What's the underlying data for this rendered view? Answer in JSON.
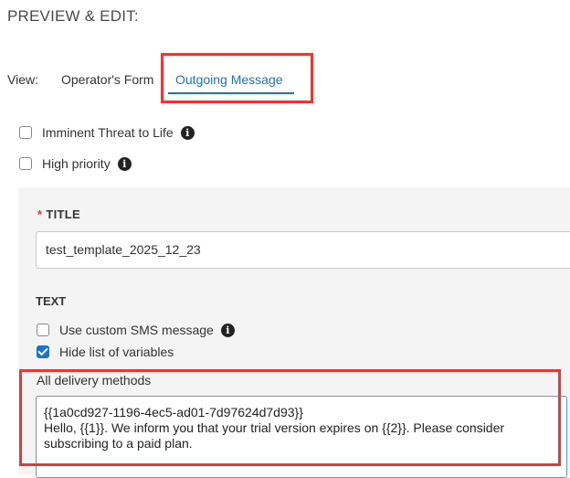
{
  "section_title": "PREVIEW & EDIT:",
  "view": {
    "label": "View:",
    "tabs": [
      {
        "label": "Operator's Form",
        "active": false
      },
      {
        "label": "Outgoing Message",
        "active": true
      }
    ]
  },
  "options": {
    "imminent_threat": {
      "label": "Imminent Threat to Life",
      "checked": false
    },
    "high_priority": {
      "label": "High priority",
      "checked": false
    }
  },
  "form": {
    "title_required_mark": "*",
    "title_label": "TITLE",
    "title_value": "test_template_2025_12_23",
    "text_label": "TEXT",
    "use_custom_sms": {
      "label": "Use custom SMS message",
      "checked": false
    },
    "hide_variables": {
      "label": "Hide list of variables",
      "checked": true
    },
    "delivery_label": "All delivery methods",
    "message_lines": [
      "{{1a0cd927-1196-4ec5-ad01-7d97624d7d93}}",
      "Hello, {{1}}. We inform you that your trial version expires on {{2}}. Please consider",
      "subscribing to a paid plan."
    ]
  },
  "colors": {
    "accent": "#1a73c8",
    "highlight_border": "#e53935",
    "panel_bg": "#f4f4f4"
  },
  "icons": {
    "info": "info-circle-icon",
    "checkmark": "checkmark-icon"
  }
}
